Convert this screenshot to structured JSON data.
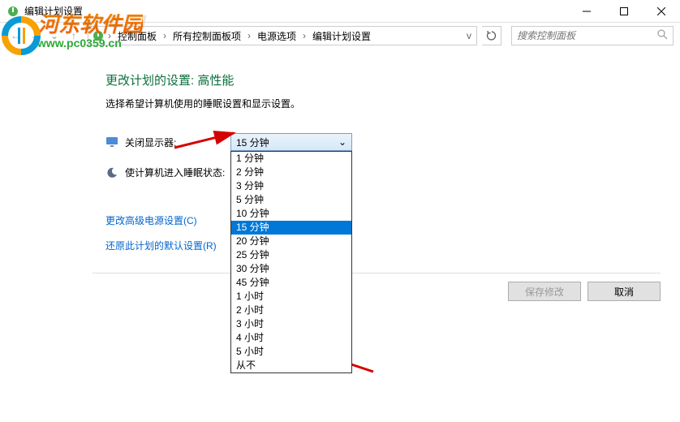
{
  "window": {
    "title": "编辑计划设置"
  },
  "breadcrumbs": {
    "items": [
      "控制面板",
      "所有控制面板项",
      "电源选项",
      "编辑计划设置"
    ]
  },
  "search": {
    "placeholder": "搜索控制面板"
  },
  "heading": {
    "title_prefix": "更改计划的设置:",
    "title_plan": "高性能",
    "subtitle": "选择希望计算机使用的睡眠设置和显示设置。"
  },
  "fields": {
    "display_off": {
      "label": "关闭显示器:",
      "value": "15 分钟"
    },
    "sleep": {
      "label": "使计算机进入睡眠状态:"
    }
  },
  "dropdown_options": [
    "1 分钟",
    "2 分钟",
    "3 分钟",
    "5 分钟",
    "10 分钟",
    "15 分钟",
    "20 分钟",
    "25 分钟",
    "30 分钟",
    "45 分钟",
    "1 小时",
    "2 小时",
    "3 小时",
    "4 小时",
    "5 小时",
    "从不"
  ],
  "dropdown_selected": "15 分钟",
  "links": {
    "advanced": "更改高级电源设置(C)",
    "restore": "还原此计划的默认设置(R)"
  },
  "buttons": {
    "save": "保存修改",
    "cancel": "取消"
  },
  "watermark": {
    "line1": "河东软件园",
    "line2": "www.pc0359.cn"
  }
}
